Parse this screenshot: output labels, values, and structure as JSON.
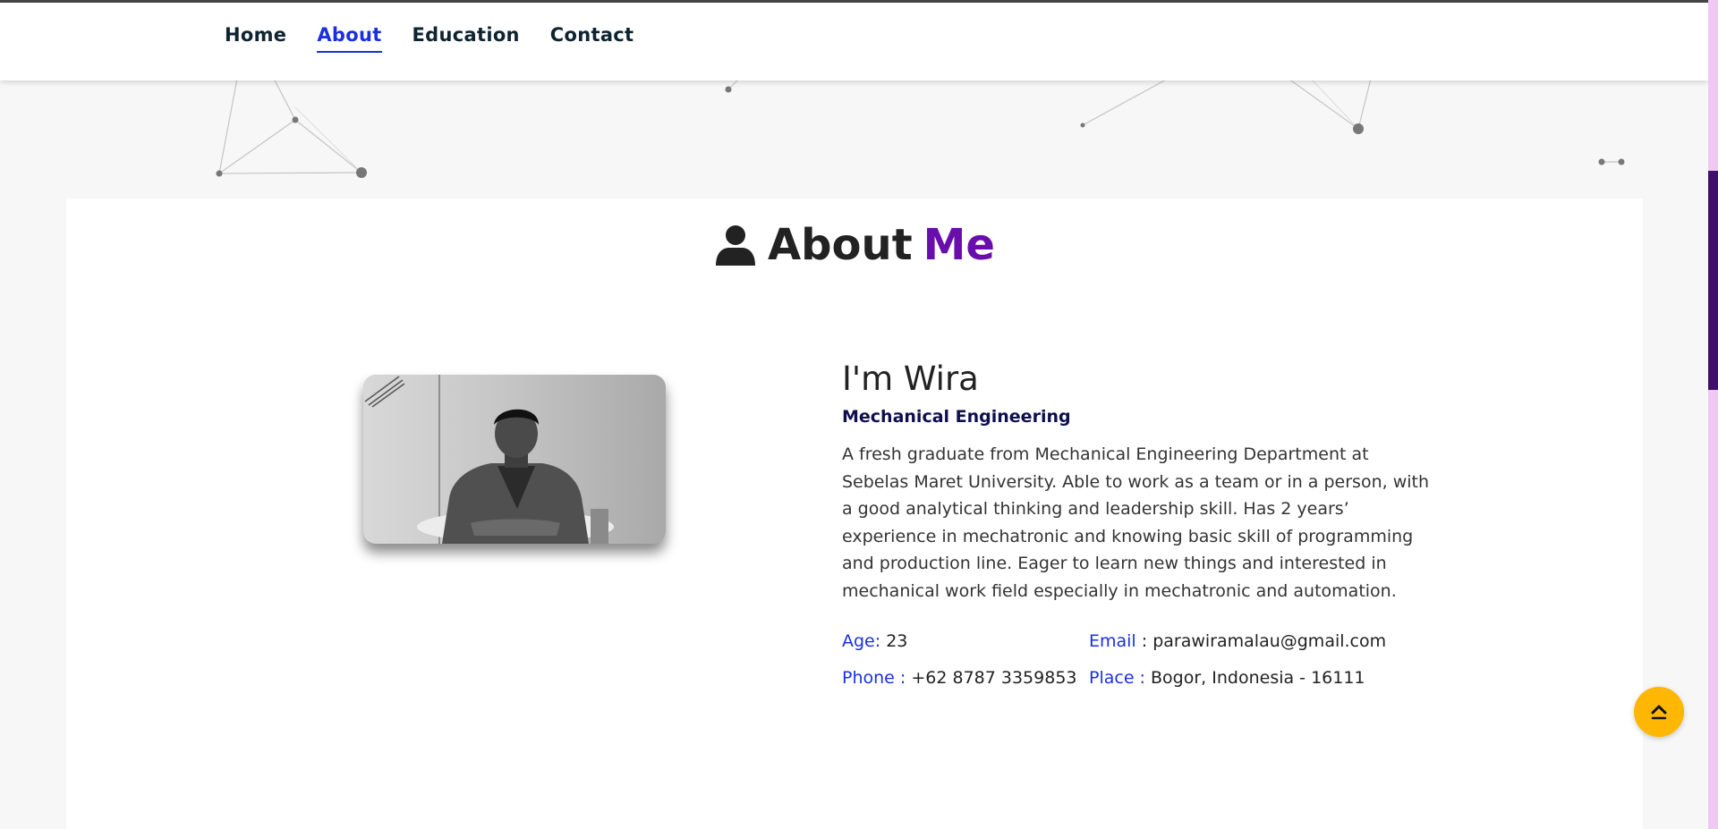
{
  "nav": {
    "items": [
      {
        "label": "Home",
        "active": false
      },
      {
        "label": "About",
        "active": true
      },
      {
        "label": "Education",
        "active": false
      },
      {
        "label": "Contact",
        "active": false
      }
    ]
  },
  "about": {
    "heading_main": "About",
    "heading_accent": "Me",
    "greeting": "I'm Wira",
    "role": "Mechanical Engineering",
    "description": "A fresh graduate from Mechanical Engineering Department at Sebelas Maret University. Able to work as a team or in a person, with a good analytical thinking and leadership skill. Has 2 years’ experience in mechatronic and knowing basic skill of programming and production line. Eager to learn new things and interested in mechanical work field especially in mechatronic and automation.",
    "info": {
      "age_label": "Age:",
      "age_value": "23",
      "email_label": "Email",
      "email_value": "parawiramalau@gmail.com",
      "phone_label": "Phone :",
      "phone_value": "+62 8787 3359853",
      "place_label": "Place :",
      "place_value": "Bogor, Indonesia - 16111"
    }
  },
  "colors": {
    "accent_blue": "#1a30e0",
    "accent_purple": "#6a0dad",
    "scroll_button": "#ffb703",
    "scrollbar_thumb": "#40106a",
    "scrollbar_track": "#f0c8f4"
  },
  "icons": {
    "heading": "user-icon",
    "scroll_top": "chevron-up-icon"
  }
}
